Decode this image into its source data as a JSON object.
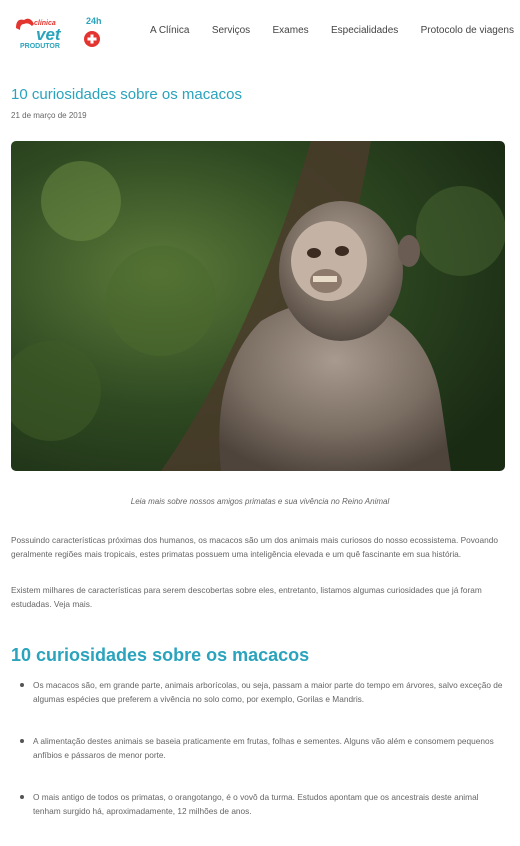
{
  "logo": {
    "line1": "clínica",
    "line2": "vet",
    "line3": "PRODUTOR",
    "badge": "24h"
  },
  "nav": [
    "A Clínica",
    "Serviços",
    "Exames",
    "Especialidades",
    "Protocolo de viagens"
  ],
  "post": {
    "title": "10 curiosidades sobre os macacos",
    "date": "21 de março de 2019",
    "caption": "Leia mais sobre nossos amigos primatas e sua vivência no Reino Animal",
    "paragraphs": [
      "Possuindo características próximas dos humanos, os macacos são um dos animais mais curiosos do nosso ecossistema. Povoando geralmente regiões mais tropicais, estes primatas possuem uma inteligência elevada e um quê fascinante em sua história.",
      "Existem milhares de características para serem descobertas sobre eles, entretanto, listamos algumas curiosidades que já foram estudadas. Veja mais."
    ],
    "section_title": "10 curiosidades sobre os macacos",
    "bullets": [
      "Os macacos são, em grande parte, animais arborícolas, ou seja, passam a maior parte do tempo em árvores, salvo exceção de algumas espécies que preferem a vivência no solo como, por exemplo, Gorilas e Mandris.",
      "A alimentação destes animais se baseia praticamente em frutas, folhas e sementes. Alguns vão além e consomem pequenos anfíbios e pássaros de menor porte.",
      "O mais antigo de todos os primatas, o orangotango, é o vovô da turma. Estudos apontam que os ancestrais deste animal tenham surgido há, aproximadamente, 12 milhões de anos."
    ]
  },
  "colors": {
    "accent": "#2aa3bd",
    "logo_red": "#e3342f"
  },
  "icons": {
    "logo_cross": "plus-cross-icon",
    "hero": "monkey-photo"
  }
}
